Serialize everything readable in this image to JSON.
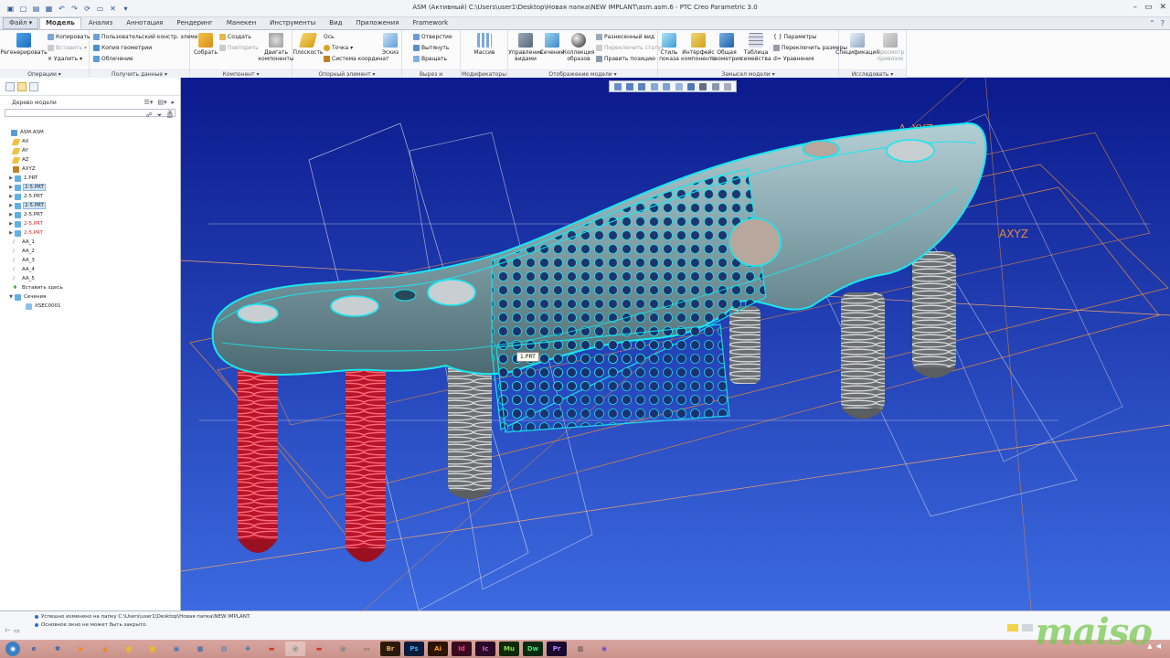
{
  "window": {
    "title": "ASM (Активный) C:\\Users\\user1\\Desktop\\Новая папка\\NEW IMPLANT\\asm.asm.6 - PTC Creo Parametric 3.0"
  },
  "tabs": [
    {
      "label": "Файл ▾"
    },
    {
      "label": "Модель"
    },
    {
      "label": "Анализ"
    },
    {
      "label": "Аннотация"
    },
    {
      "label": "Рендеринг"
    },
    {
      "label": "Манекен"
    },
    {
      "label": "Инструменты"
    },
    {
      "label": "Вид"
    },
    {
      "label": "Приложения"
    },
    {
      "label": "Framework"
    }
  ],
  "ribbon": {
    "regen": "Регенерировать",
    "copy": "Копировать",
    "paste": "Вставить ▾",
    "delete": "✕ Удалить ▾",
    "user_elem": "Пользовательский констр. элемент",
    "copy_geom": "Копия геометрии",
    "shrinkwrap": "Облечение",
    "assemble": "Собрать",
    "create": "Создать",
    "repeat": "Повторить",
    "drag": "Двигать компоненты",
    "plane": "Плоскость",
    "axis": "Ось",
    "point": "Точка ▾",
    "csys": "Система координат",
    "sketch": "Эскиз",
    "hole": "Отверстие",
    "extrude": "Вытянуть",
    "revolve": "Вращать",
    "pattern": "Массив",
    "manage_views": "Управление видами",
    "section": "Сечение",
    "appearance": "Коллекция образов",
    "exploded": "Разнесенный вид",
    "toggle_status": "Переключить статус",
    "edit_position": "Править позицию",
    "display_style": "Стиль показа",
    "interface": "Интерфейс компонента",
    "common_geom": "Общая геометрия",
    "family_table": "Таблица семейства",
    "params": "Параметры",
    "switch_dims": "Переключить размеры",
    "relations": "Уравнения",
    "bom": "Спецификация",
    "view_links": "Просмотр привязок"
  },
  "groups": [
    {
      "name": "Операции ▾"
    },
    {
      "name": "Получить данные ▾"
    },
    {
      "name": "Компонент ▾"
    },
    {
      "name": "Опорный элемент ▾"
    },
    {
      "name": "Вырез и поверхность ▾"
    },
    {
      "name": "Модификаторы ▾"
    },
    {
      "name": "Отображение модели ▾"
    },
    {
      "name": "Замысел модели ▾"
    },
    {
      "name": "Исследовать ▾"
    }
  ],
  "model_tree": {
    "title": "Дерево модели",
    "items": [
      {
        "label": "ASM.ASM"
      },
      {
        "label": "AX"
      },
      {
        "label": "AY"
      },
      {
        "label": "AZ"
      },
      {
        "label": "AXYZ"
      },
      {
        "label": "1.PRT"
      },
      {
        "label": "2-5.PRT"
      },
      {
        "label": "2-5.PRT"
      },
      {
        "label": "2-5.PRT"
      },
      {
        "label": "2-5.PRT"
      },
      {
        "label": "2-5.PRT"
      },
      {
        "label": "2-5.PRT"
      },
      {
        "label": "AA_1"
      },
      {
        "label": "AA_2"
      },
      {
        "label": "AA_3"
      },
      {
        "label": "AA_4"
      },
      {
        "label": "AA_5"
      },
      {
        "label": "Вставить здесь"
      },
      {
        "label": "Сечения"
      },
      {
        "label": "XSEC0001"
      }
    ]
  },
  "viewport": {
    "tooltip": "1.PRT",
    "label_axyz_1": "A_XYZ",
    "label_axyz_2": "AXYZ"
  },
  "messages": [
    {
      "text": "Успешно изменено на папку C:\\Users\\user1\\Desktop\\Новая папка\\NEW IMPLANT."
    },
    {
      "text": "Основное окно не может быть закрыто."
    }
  ],
  "taskbar": [
    {
      "label": "Br"
    },
    {
      "label": "Ps"
    },
    {
      "label": "Ai"
    },
    {
      "label": "Id"
    },
    {
      "label": "Ic"
    },
    {
      "label": "Mu"
    },
    {
      "label": "Dw"
    },
    {
      "label": "Pr"
    }
  ],
  "watermark": "maiso",
  "colors": {
    "viewport_top": "#0b1a8c",
    "viewport_bottom": "#3c6ae0",
    "accent_cyan": "#19e6f0",
    "screw_red": "#e5203a"
  }
}
